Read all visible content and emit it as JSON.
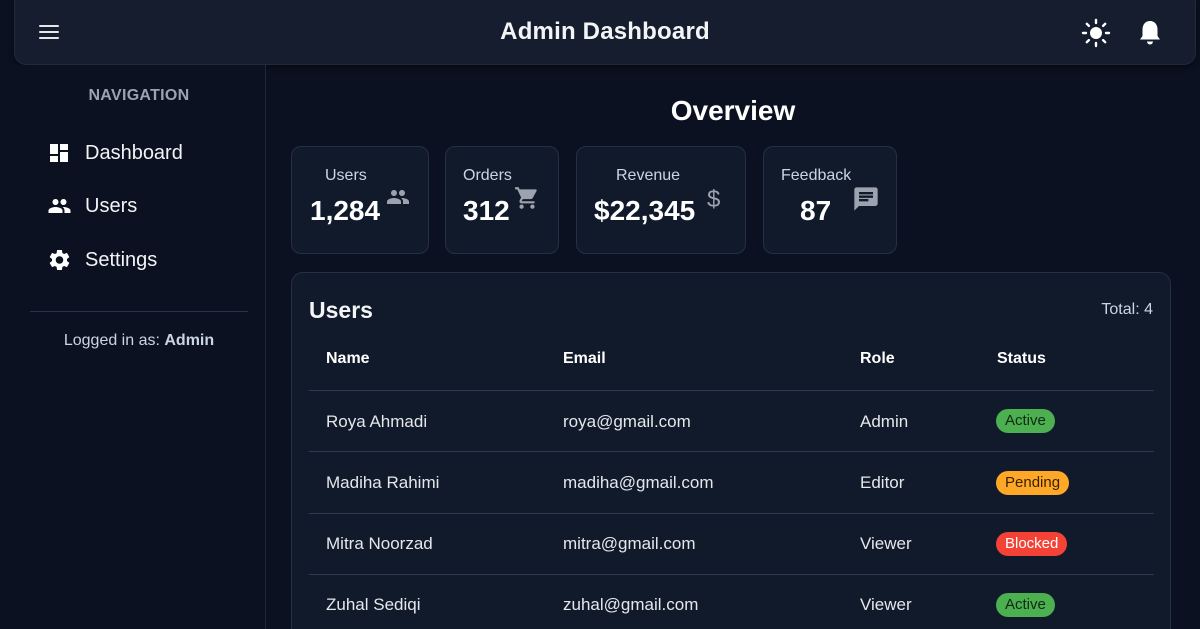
{
  "header": {
    "title": "Admin Dashboard",
    "menu_icon": "hamburger-menu-icon",
    "theme_icon": "sun-icon",
    "notification_icon": "bell-icon"
  },
  "sidebar": {
    "heading": "NAVIGATION",
    "items": [
      {
        "label": "Dashboard",
        "icon": "dashboard-icon"
      },
      {
        "label": "Users",
        "icon": "users-icon"
      },
      {
        "label": "Settings",
        "icon": "gear-icon"
      }
    ],
    "logged_in_prefix": "Logged in as:",
    "logged_in_user": "Admin"
  },
  "main": {
    "title": "Overview",
    "stats": [
      {
        "label": "Users",
        "value": "1,284",
        "icon": "users-icon"
      },
      {
        "label": "Orders",
        "value": "312",
        "icon": "cart-icon"
      },
      {
        "label": "Revenue",
        "value": "$22,345",
        "icon": "dollar-icon"
      },
      {
        "label": "Feedback",
        "value": "87",
        "icon": "chat-icon"
      }
    ]
  },
  "users_table": {
    "title": "Users",
    "total": "Total: 4",
    "columns": [
      "Name",
      "Email",
      "Role",
      "Status"
    ],
    "rows": [
      {
        "name": "Roya Ahmadi",
        "email": "roya@gmail.com",
        "role": "Admin",
        "status": "Active"
      },
      {
        "name": "Madiha Rahimi",
        "email": "madiha@gmail.com",
        "role": "Editor",
        "status": "Pending"
      },
      {
        "name": "Mitra Noorzad",
        "email": "mitra@gmail.com",
        "role": "Viewer",
        "status": "Blocked"
      },
      {
        "name": "Zuhal Sediqi",
        "email": "zuhal@gmail.com",
        "role": "Viewer",
        "status": "Active"
      }
    ]
  },
  "colors": {
    "background": "#0b1120",
    "card": "#111a2b",
    "status_active": "#4caf50",
    "status_pending": "#ffa726",
    "status_blocked": "#f44336"
  }
}
